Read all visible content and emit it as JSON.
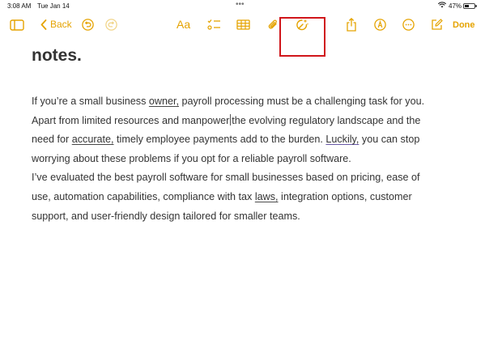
{
  "status_bar": {
    "time": "3:08 AM",
    "date": "Tue Jan 14",
    "multitask_dots": "•••",
    "battery_percent": "47%",
    "battery_level": 0.47
  },
  "toolbar": {
    "back_label": "Back",
    "format_label": "Aa",
    "done_label": "Done",
    "accent_color": "#E5A300",
    "highlight_color": "#D0161B",
    "icons": [
      "sidebar-icon",
      "chevron-left-icon",
      "undo-icon",
      "redo-icon",
      "checklist-icon",
      "table-icon",
      "paperclip-icon",
      "apple-intelligence-icon",
      "share-icon",
      "markup-icon",
      "more-icon",
      "compose-icon"
    ]
  },
  "note": {
    "title": "notes.",
    "lines": [
      {
        "segments": [
          {
            "text": "If you’re a small business "
          },
          {
            "text": "owner,",
            "underline": true
          },
          {
            "text": " payroll processing must be a challenging task for you."
          }
        ]
      },
      {
        "segments": [
          {
            "text": "Apart from limited resources and manpower"
          },
          {
            "cursor": true
          },
          {
            "text": "the evolving regulatory landscape and the"
          }
        ]
      },
      {
        "segments": [
          {
            "text": "need for "
          },
          {
            "text": "accurate,",
            "underline": true
          },
          {
            "text": " timely employee payments add to the burden. "
          },
          {
            "text": "Luckily,",
            "underline": true,
            "purple": true
          },
          {
            "text": " you can stop"
          }
        ]
      },
      {
        "segments": [
          {
            "text": "worrying about these problems if you opt for a reliable payroll software."
          }
        ]
      },
      {
        "segments": [
          {
            "text": "I’ve evaluated the best payroll software for small businesses based on pricing, ease of"
          }
        ]
      },
      {
        "segments": [
          {
            "text": "use, automation capabilities, compliance with tax "
          },
          {
            "text": "laws,",
            "underline": true
          },
          {
            "text": " integration options, customer"
          }
        ]
      },
      {
        "segments": [
          {
            "text": "support, and user-friendly design tailored for smaller teams."
          }
        ]
      }
    ]
  }
}
